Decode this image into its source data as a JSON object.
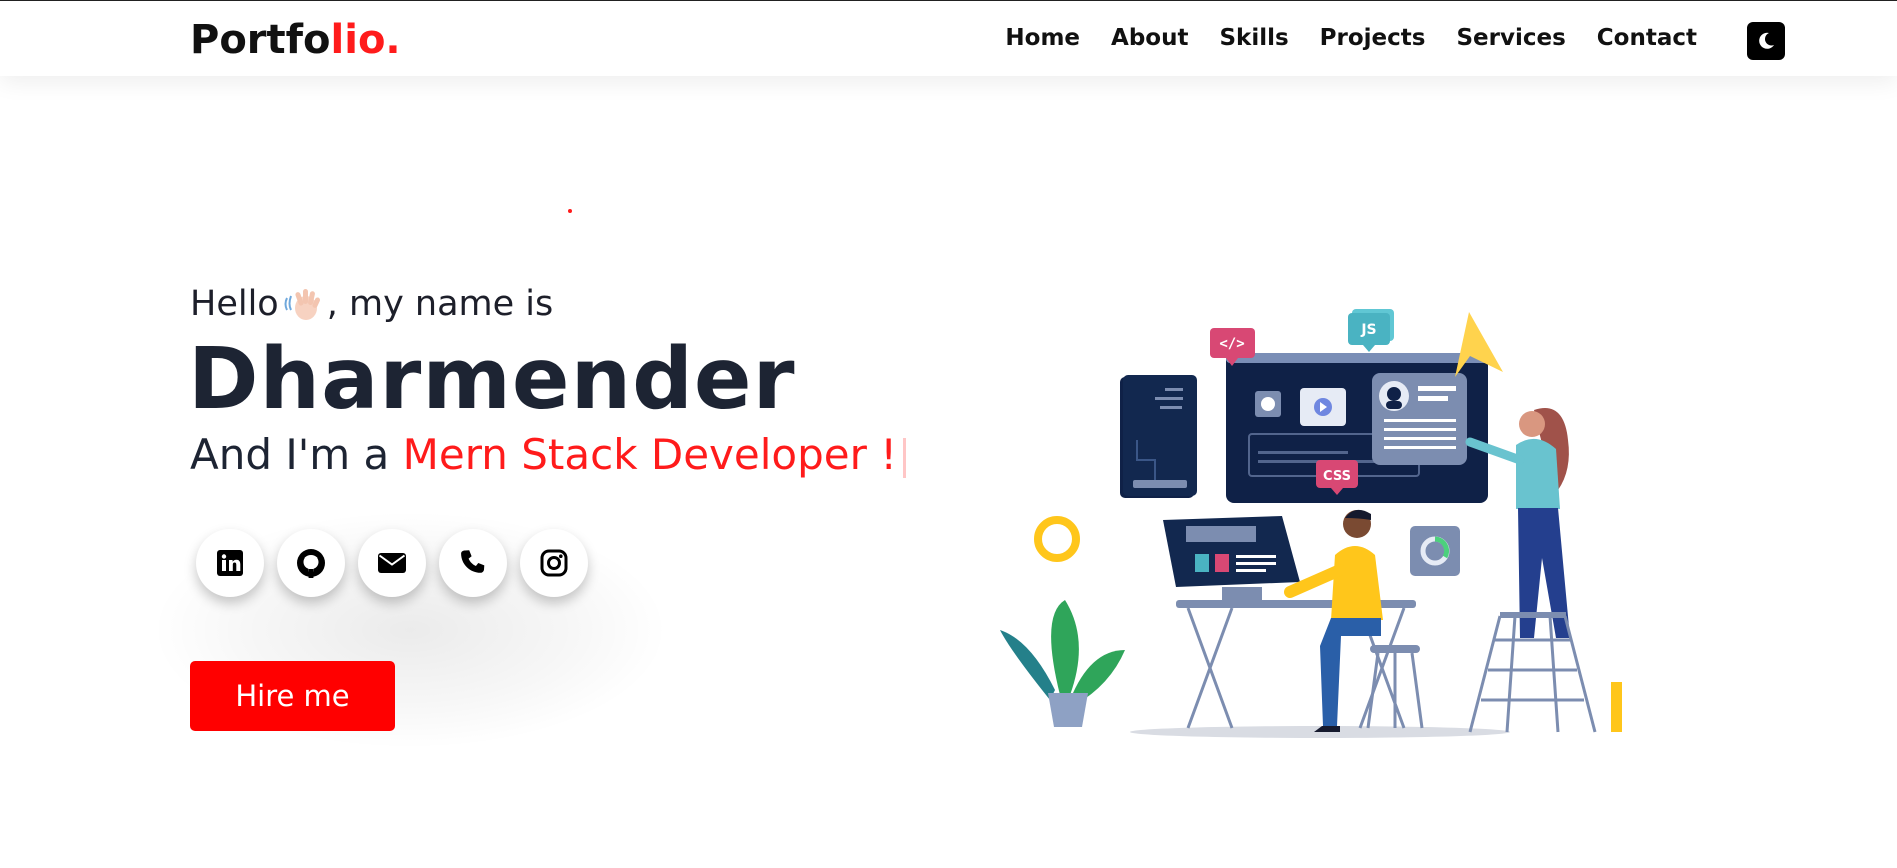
{
  "header": {
    "logo_main": "Portfo",
    "logo_accent": "lio.",
    "nav": [
      "Home",
      "About",
      "Skills",
      "Projects",
      "Services",
      "Contact"
    ],
    "theme_toggle_icon": "moon-icon"
  },
  "hero": {
    "greeting_before": "Hello",
    "greeting_after": ", my name is",
    "wave_icon": "waving-hand-icon",
    "name": "Dharmender",
    "role_prefix": "And I'm a ",
    "role_typed": "Mern Stack Developer !",
    "socials": [
      "linkedin-icon",
      "github-icon",
      "envelope-icon",
      "phone-icon",
      "instagram-icon"
    ],
    "hire_label": "Hire me"
  },
  "illustration": {
    "tag_code": "</>",
    "tag_js": "JS",
    "tag_css": "CSS"
  },
  "colors": {
    "accent": "#ff1b1b",
    "dark": "#1d2433",
    "navy": "#0f2147",
    "yellow": "#ffc61b"
  }
}
